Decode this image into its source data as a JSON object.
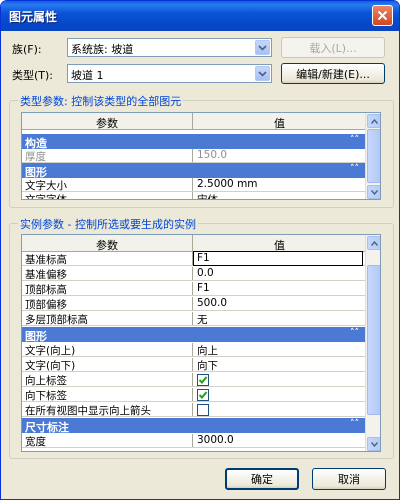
{
  "window": {
    "title": "图元属性"
  },
  "family": {
    "label": "族(F):",
    "value": "系统族: 坡道"
  },
  "type": {
    "label": "类型(T):",
    "value": "坡道 1"
  },
  "buttons": {
    "load": "载入(L)...",
    "edit_new": "编辑/新建(E)...",
    "ok": "确定",
    "cancel": "取消"
  },
  "type_params": {
    "title": "类型参数: 控制该类型的全部图元",
    "header_param": "参数",
    "header_value": "值",
    "rows": [
      {
        "kind": "category",
        "label": "构造"
      },
      {
        "kind": "row",
        "key": "厚度",
        "value": "150.0",
        "greyed": true
      },
      {
        "kind": "category",
        "label": "图形"
      },
      {
        "kind": "row",
        "key": "文字大小",
        "value": "2.5000 mm"
      },
      {
        "kind": "row",
        "key": "文字字体",
        "value": "宋体"
      }
    ]
  },
  "instance_params": {
    "title": "实例参数 - 控制所选或要生成的实例",
    "header_param": "参数",
    "header_value": "值",
    "rows": [
      {
        "kind": "row",
        "key": "基准标高",
        "value": "F1"
      },
      {
        "kind": "row",
        "key": "基准偏移",
        "value": "0.0"
      },
      {
        "kind": "row",
        "key": "顶部标高",
        "value": "F1"
      },
      {
        "kind": "row",
        "key": "顶部偏移",
        "value": "500.0"
      },
      {
        "kind": "row",
        "key": "多层顶部标高",
        "value": "无"
      },
      {
        "kind": "category",
        "label": "图形"
      },
      {
        "kind": "row",
        "key": "文字(向上)",
        "value": "向上"
      },
      {
        "kind": "row",
        "key": "文字(向下)",
        "value": "向下"
      },
      {
        "kind": "check",
        "key": "向上标签",
        "checked": true
      },
      {
        "kind": "check",
        "key": "向下标签",
        "checked": true
      },
      {
        "kind": "check",
        "key": "在所有视图中显示向上箭头",
        "checked": false
      },
      {
        "kind": "category",
        "label": "尺寸标注"
      },
      {
        "kind": "row",
        "key": "宽度",
        "value": "3000.0"
      }
    ]
  }
}
